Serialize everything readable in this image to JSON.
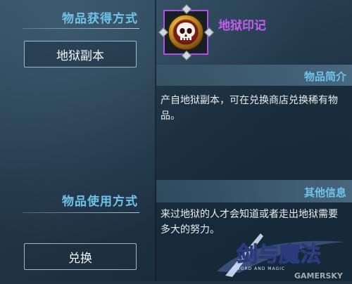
{
  "left": {
    "acquire_title": "物品获得方式",
    "acquire_button": "地狱副本",
    "usage_title": "物品使用方式",
    "usage_button": "兑换"
  },
  "item": {
    "name": "地狱印记",
    "icon": "skull-medal-icon",
    "frame_color": "#b04fe0"
  },
  "sections": {
    "intro_title": "物品简介",
    "intro_text": "产自地狱副本，可在兑换商店兑换稀有物品。",
    "other_title": "其他信息",
    "other_text": "来过地狱的人才会知道或者走出地狱需要多大的努力。"
  },
  "watermark": {
    "logo_text": "剑与魔法",
    "site_text": "GAMERSKY"
  }
}
